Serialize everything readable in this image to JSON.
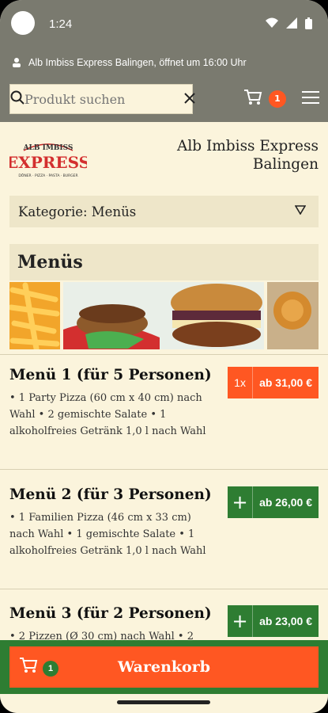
{
  "status_bar": {
    "time": "1:24"
  },
  "info_bar": {
    "text": "Alb Imbiss Express Balingen, öffnet um 16:00 Uhr"
  },
  "header": {
    "search_placeholder": "Produkt suchen",
    "cart_count": "1"
  },
  "restaurant": {
    "name_line1": "Alb Imbiss Express",
    "name_line2": "Balingen",
    "logo_lines": [
      "ALB IMBISS",
      "EXPRESS",
      "DÖNER · PIZZA · PASTA · BURGER"
    ]
  },
  "category": {
    "label": "Kategorie: Menüs"
  },
  "section": {
    "title": "Menüs"
  },
  "items": [
    {
      "title": "Menü 1 (für 5 Personen)",
      "desc": "• 1 Party Pizza (60 cm x 40 cm) nach Wahl • 2 gemischte Salate • 1 alkoholfreies Getränk 1,0 l nach Wahl",
      "qty": "1x",
      "price": "ab 31,00 €"
    },
    {
      "title": "Menü 2 (für 3 Personen)",
      "desc": "• 1 Familien Pizza (46 cm x 33 cm) nach Wahl • 1 gemischte Salate • 1 alkoholfreies Getränk 1,0 l nach Wahl",
      "qty": "+",
      "price": "ab 26,00 €"
    },
    {
      "title": "Menü 3 (für 2 Personen)",
      "desc": "• 2 Pizzen (Ø 30 cm) nach Wahl • 2",
      "qty": "+",
      "price": "ab 23,00 €"
    }
  ],
  "bottom_cart": {
    "label": "Warenkorb",
    "count": "1"
  },
  "colors": {
    "accent_orange": "#ff5722",
    "accent_green": "#2e7d32",
    "background": "#fbf4dc",
    "header_gray": "#7a7a6f"
  }
}
